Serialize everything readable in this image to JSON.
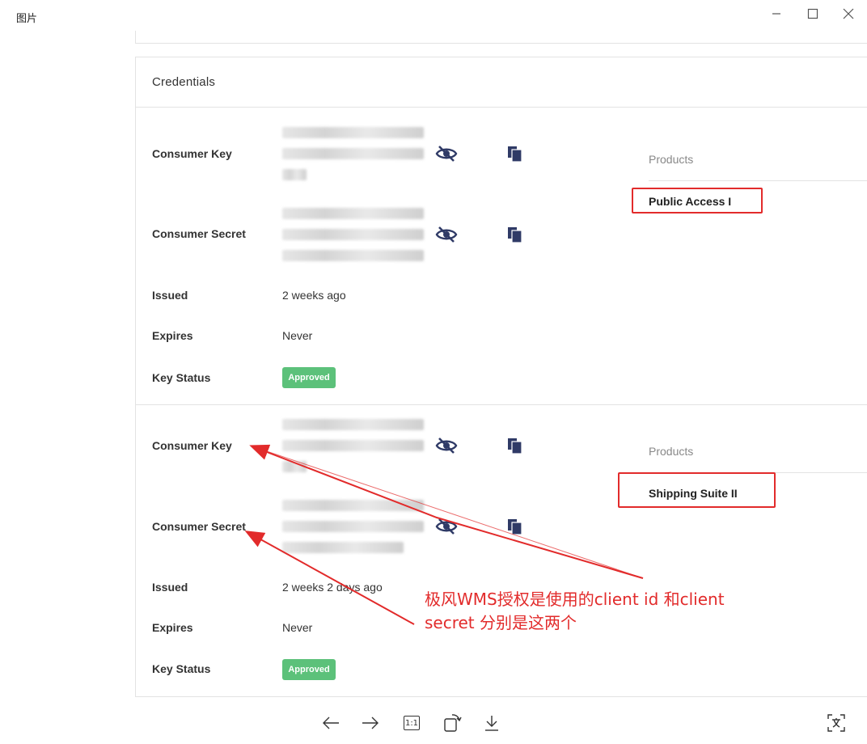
{
  "window": {
    "title": "图片"
  },
  "credentials": {
    "title": "Credentials",
    "keys": [
      {
        "consumer_key_label": "Consumer Key",
        "consumer_secret_label": "Consumer Secret",
        "issued_label": "Issued",
        "issued_value": "2 weeks ago",
        "expires_label": "Expires",
        "expires_value": "Never",
        "status_label": "Key Status",
        "status_value": "Approved",
        "products_label": "Products",
        "product": "Public Access I"
      },
      {
        "consumer_key_label": "Consumer Key",
        "consumer_secret_label": "Consumer Secret",
        "issued_label": "Issued",
        "issued_value": "2 weeks 2 days ago",
        "expires_label": "Expires",
        "expires_value": "Never",
        "status_label": "Key Status",
        "status_value": "Approved",
        "products_label": "Products",
        "product": "Shipping Suite II"
      }
    ]
  },
  "annotation": {
    "line1": "极风WMS授权是使用的client id 和client",
    "line2": "secret 分别是这两个"
  },
  "toolbar": {
    "one_to_one": "1:1"
  },
  "colors": {
    "accent_red": "#e22b2b",
    "approved_green": "#5cc17a",
    "icon_navy": "#2f3a66"
  },
  "icons": [
    "eye-off-icon",
    "copy-icon",
    "arrow-left-icon",
    "arrow-right-icon",
    "rotate-icon",
    "download-icon",
    "translate-icon"
  ]
}
